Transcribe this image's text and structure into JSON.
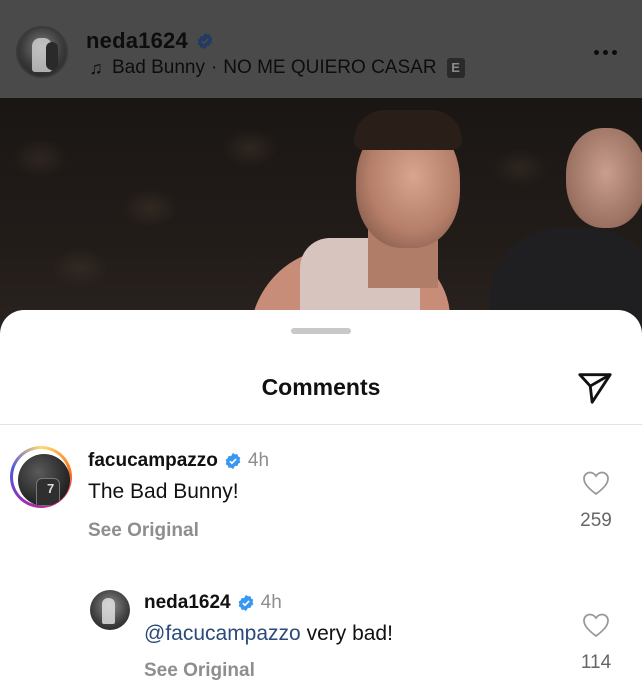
{
  "post": {
    "username": "neda1624",
    "music_artist": "Bad Bunny",
    "music_separator": "·",
    "music_title": "NO ME QUIERO CASAR",
    "explicit_badge": "E"
  },
  "sheet": {
    "title": "Comments"
  },
  "comments": [
    {
      "username": "facucampazzo",
      "time": "4h",
      "text": "The Bad Bunny!",
      "see_original": "See Original",
      "likes": "259"
    },
    {
      "username": "neda1624",
      "time": "4h",
      "mention": "@facucampazzo",
      "text": " very bad!",
      "see_original": "See Original",
      "likes": "114"
    }
  ],
  "colors": {
    "verified": "#3897f0",
    "mention": "#2b4a7a",
    "secondary_text": "#8e8e8e"
  },
  "icons": {
    "verified": "verified-badge-icon",
    "music": "music-note-icon",
    "more": "more-options-icon",
    "share": "paper-plane-icon",
    "like": "heart-outline-icon"
  }
}
